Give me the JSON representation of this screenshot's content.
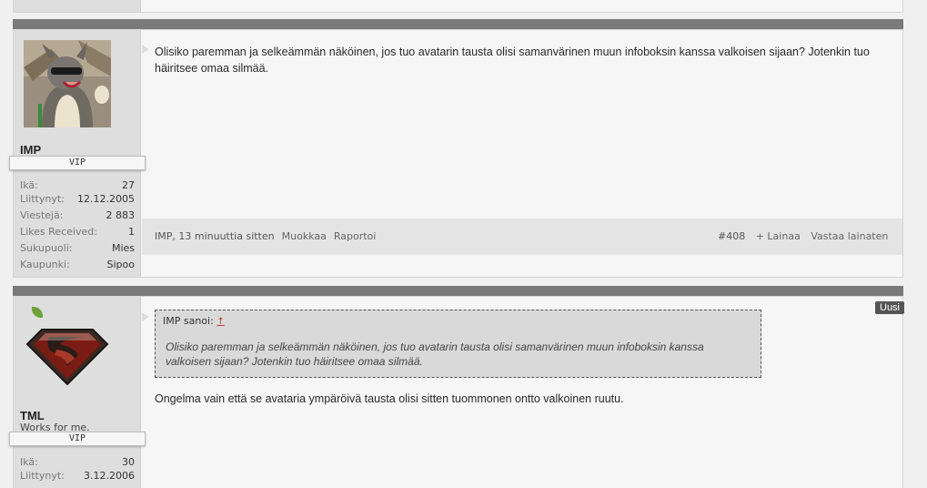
{
  "posts": [
    {
      "username": "IMP",
      "user_title": "VIP",
      "info": [
        {
          "label": "Ikä:",
          "value": "27"
        },
        {
          "label": "Liittynyt:",
          "value": "12.12.2005"
        },
        {
          "label": "Viestejä:",
          "value": "2 883"
        },
        {
          "label": "Likes Received:",
          "value": "1"
        },
        {
          "label": "Sukupuoli:",
          "value": "Mies"
        },
        {
          "label": "Kaupunki:",
          "value": "Sipoo"
        }
      ],
      "message": "Olisiko paremman ja selkeämmän näköinen, jos tuo avatarin tausta olisi samanvärinen muun infoboksin kanssa valkoisen sijaan? Jotenkin tuo häiritsee omaa silmää.",
      "footer": {
        "author_time": "IMP, 13 minuuttia sitten",
        "edit": "Muokkaa",
        "report": "Raportoi",
        "post_number": "#408",
        "quote": "+ Lainaa",
        "reply": "Vastaa lainaten"
      }
    },
    {
      "username": "TML",
      "custom_title": "Works for me.",
      "user_title": "VIP",
      "badge": "Uusi",
      "info": [
        {
          "label": "Ikä:",
          "value": "30"
        },
        {
          "label": "Liittynyt:",
          "value": "3.12.2006"
        }
      ],
      "quote": {
        "header": "IMP sanoi:",
        "arrow": "↑",
        "text": "Olisiko paremman ja selkeämmän näköinen, jos tuo avatarin tausta olisi samanvärinen muun infoboksin kanssa valkoisen sijaan? Jotenkin tuo häiritsee omaa silmää."
      },
      "message": "Ongelma vain että se avataria ympäröivä tausta olisi sitten tuommonen ontto valkoinen ruutu."
    }
  ],
  "colors": {
    "post_bar": "#7a7a7a",
    "sidebar": "#dedede",
    "online": "#6ca33b",
    "badge": "#555555"
  }
}
